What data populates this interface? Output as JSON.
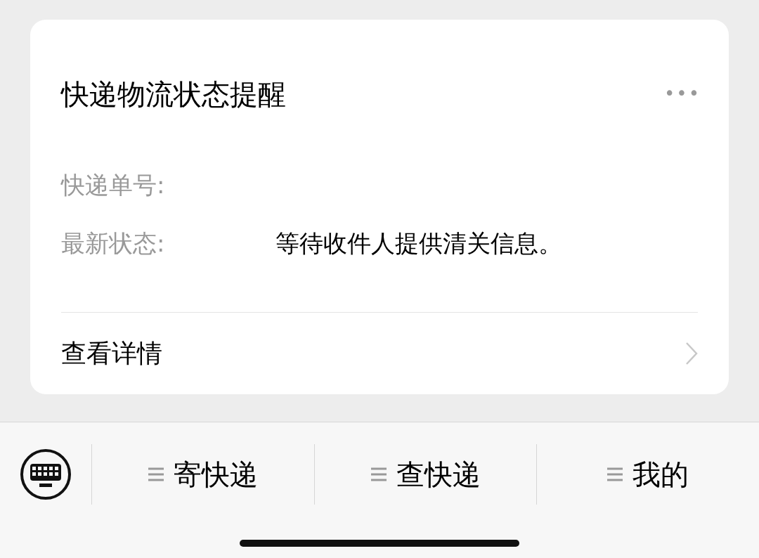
{
  "card": {
    "title": "快递物流状态提醒",
    "more": "•••",
    "fields": [
      {
        "label": "快递单号:"
      },
      {
        "label": "最新状态:",
        "value": "等待收件人提供清关信息。"
      }
    ],
    "link": "查看详情"
  },
  "menu": [
    {
      "label": "寄快递"
    },
    {
      "label": "查快递"
    },
    {
      "label": "我的"
    }
  ]
}
